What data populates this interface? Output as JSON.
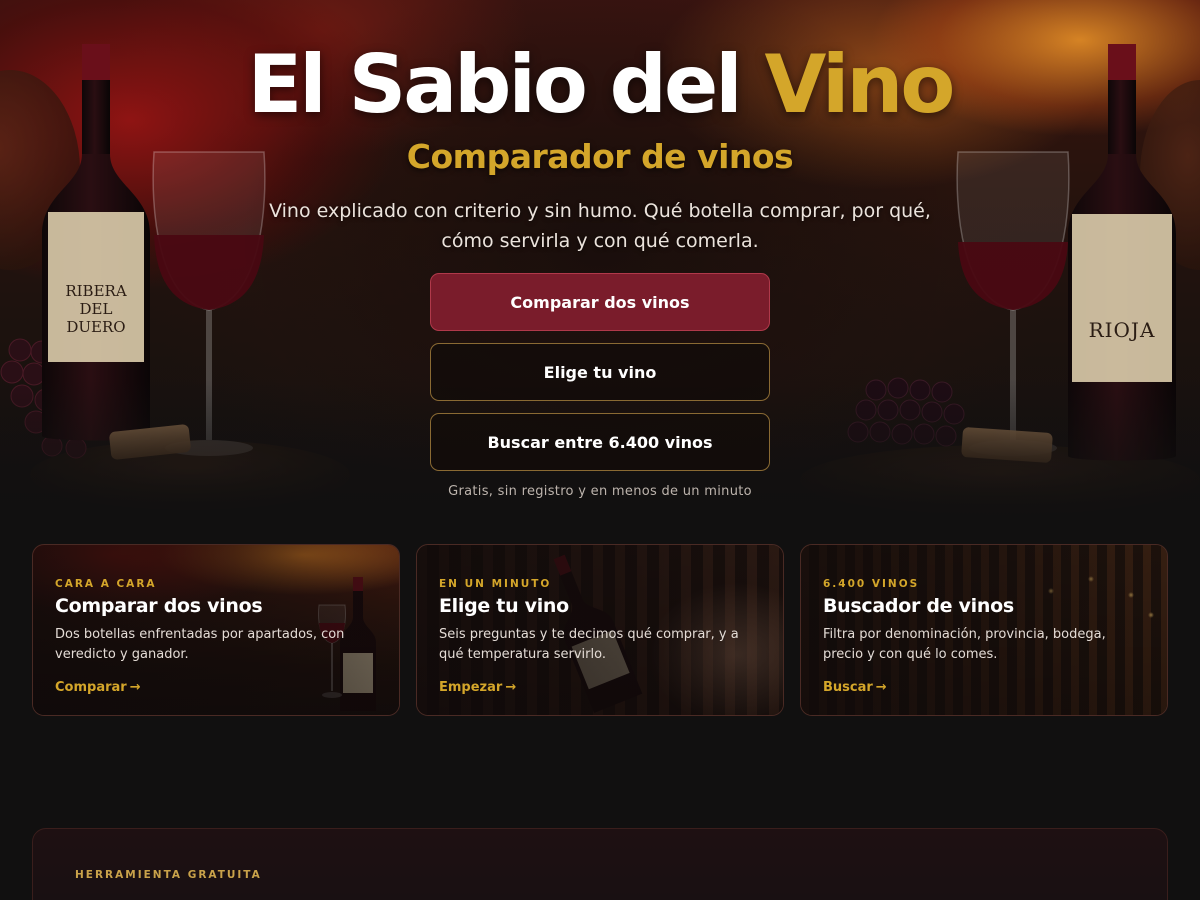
{
  "hero": {
    "title_main": "El Sabio del ",
    "title_accent": "Vino",
    "subtitle": "Comparador de vinos",
    "description": "Vino explicado con criterio y sin humo. Qué botella comprar, por qué, cómo servirla y con qué comerla.",
    "buttons": [
      {
        "label": "Comparar dos vinos"
      },
      {
        "label": "Elige tu vino"
      },
      {
        "label": "Buscar entre 6.400 vinos"
      }
    ],
    "note": "Gratis, sin registro y en menos de un minuto",
    "left_bottle_label": "RIBERA DEL DUERO",
    "right_bottle_label": "RIOJA"
  },
  "cards": [
    {
      "eyebrow": "CARA A CARA",
      "title": "Comparar dos vinos",
      "description": "Dos botellas enfrentadas por apartados, con veredicto y ganador.",
      "link": "Comparar"
    },
    {
      "eyebrow": "EN UN MINUTO",
      "title": "Elige tu vino",
      "description": "Seis preguntas y te decimos qué comprar, y a qué temperatura servirlo.",
      "link": "Empezar"
    },
    {
      "eyebrow": "6.400 VINOS",
      "title": "Buscador de vinos",
      "description": "Filtra por denominación, provincia, bodega, precio y con qué lo comes.",
      "link": "Buscar"
    }
  ],
  "panel": {
    "eyebrow": "HERRAMIENTA GRATUITA"
  },
  "colors": {
    "accent_gold": "#d4a62a",
    "primary_burgundy": "#7a1c2b",
    "background": "#111010"
  }
}
